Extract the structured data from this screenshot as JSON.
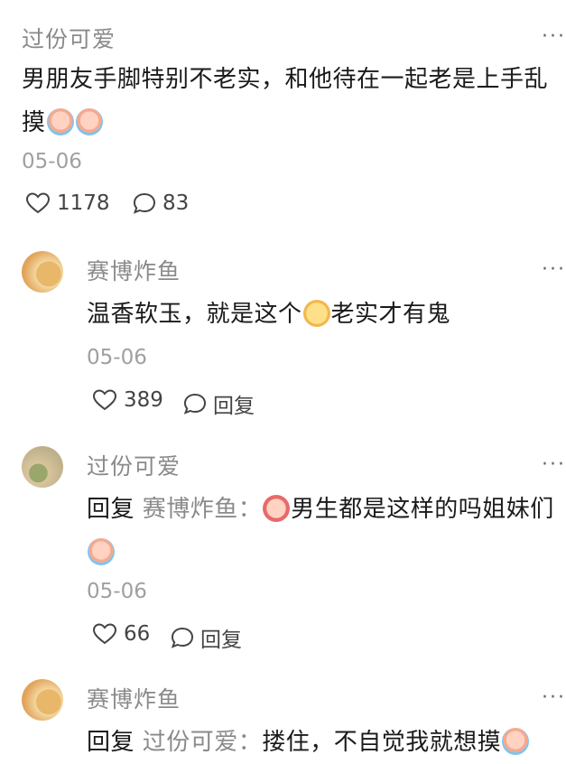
{
  "main_post": {
    "author": "过份可爱",
    "text": "男朋友手脚特别不老实，和他待在一起老是上手乱摸",
    "date": "05-06",
    "likes": "1178",
    "comments": "83"
  },
  "replies": [
    {
      "author": "赛博炸鱼",
      "text_before": "温香软玉，就是这个",
      "text_after": "老实才有鬼",
      "date": "05-06",
      "likes": "389",
      "reply_label": "回复"
    },
    {
      "author": "过份可爱",
      "reply_prefix": "回复",
      "reply_to": "赛博炸鱼：",
      "text": "男生都是这样的吗姐妹们",
      "date": "05-06",
      "likes": "66",
      "reply_label": "回复"
    },
    {
      "author": "赛博炸鱼",
      "reply_prefix": "回复",
      "reply_to": "过份可爱：",
      "text": "搂住，不自觉我就想摸"
    }
  ],
  "icons": {
    "like": "heart-outline-icon",
    "comment": "speech-bubble-icon",
    "more": "more-dots-icon"
  },
  "more_symbol": "···",
  "colors": {
    "text": "#1a1a1a",
    "secondary": "#8a8a8a"
  }
}
